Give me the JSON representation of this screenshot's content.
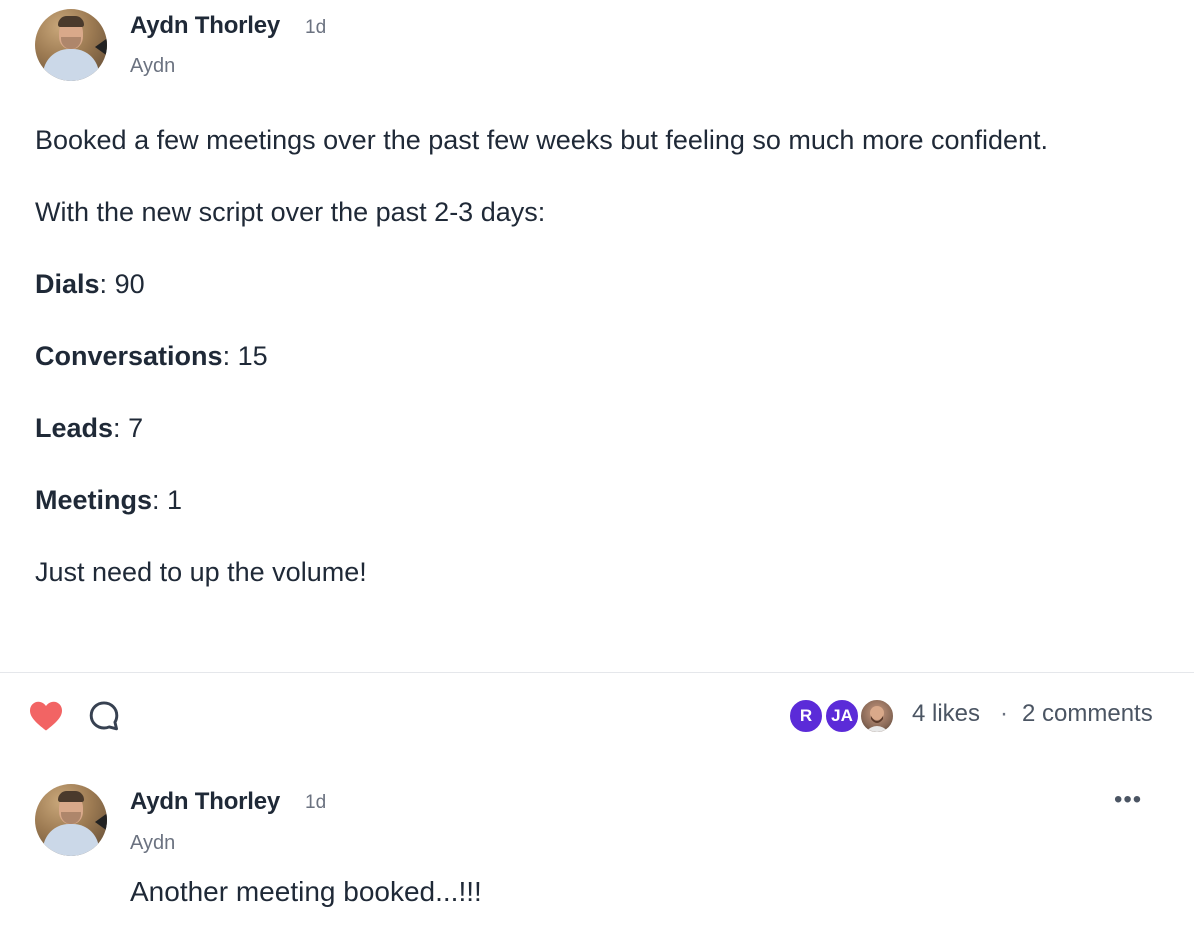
{
  "post": {
    "author": "Aydn Thorley",
    "time": "1d",
    "handle": "Aydn",
    "intro": "Booked a few meetings over the past few weeks but feeling so much more confident.",
    "script_line": "With the new script over the past 2-3 days:",
    "stats": [
      {
        "label": "Dials",
        "value": "90"
      },
      {
        "label": "Conversations",
        "value": "15"
      },
      {
        "label": "Leads",
        "value": "7"
      },
      {
        "label": "Meetings",
        "value": "1"
      }
    ],
    "closing": "Just need to up the volume!"
  },
  "actions": {
    "like_icon": "heart-icon",
    "comment_icon": "comment-bubble-icon",
    "liked": true,
    "likers": [
      {
        "initials": "R",
        "color": "#5b2bd8"
      },
      {
        "initials": "JA",
        "color": "#5b2bd8"
      },
      {
        "initials": "",
        "color": "#8a6a58"
      }
    ],
    "likes": "4 likes",
    "separator": "·",
    "comments": "2 comments"
  },
  "comment": {
    "author": "Aydn Thorley",
    "time": "1d",
    "handle": "Aydn",
    "text": "Another meeting booked...!!!",
    "more_icon": "more-horizontal-icon",
    "more_label": "•••"
  },
  "colors": {
    "heart": "#f26464",
    "text": "#1f2937",
    "muted": "#6b7280",
    "divider": "#e5e7eb",
    "liker_purple": "#5b2bd8"
  }
}
